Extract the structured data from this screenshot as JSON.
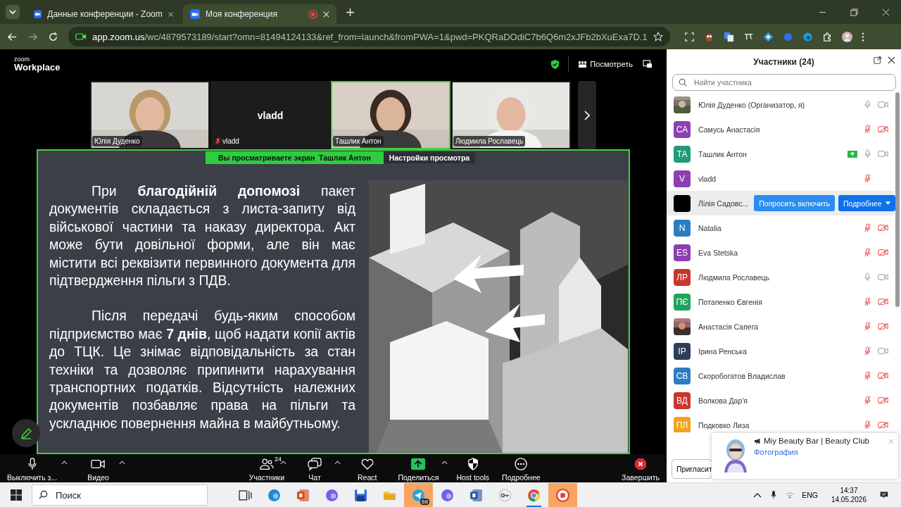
{
  "browser": {
    "tabs": [
      {
        "title": "Данные конференции - Zoom",
        "selected": false,
        "recording": false
      },
      {
        "title": "Моя конференция",
        "selected": true,
        "recording": true
      }
    ],
    "url": {
      "host": "app.zoom.us",
      "path": "/wc/4879573189/start?omn=81494124133&ref_from=launch&fromPWA=1&pwd=PKQRaDOdiC7b6Q6m2xJFb2bXuExa7D.1"
    }
  },
  "zoom": {
    "logo": {
      "top": "zoom",
      "bottom": "Workplace"
    },
    "view_button": "Посмотреть",
    "tiles": [
      {
        "kind": "video",
        "name": "Юлія Дуденко",
        "muted": false,
        "speaking": false
      },
      {
        "kind": "name",
        "display_name": "vladd",
        "name": "vladd",
        "muted": true,
        "speaking": false
      },
      {
        "kind": "video",
        "name": "Ташлик Антон",
        "muted": false,
        "speaking": true
      },
      {
        "kind": "video",
        "name": "Людмила Рославець",
        "muted": false,
        "speaking": false
      }
    ],
    "share_banner": {
      "text": "Вы просматриваете экран  Ташлик Антон",
      "settings": "Настройки просмотра"
    },
    "slide": {
      "paragraphs": [
        "При **благодійній допомозі** пакет документів складається з листа-запиту від військової частини та наказу директора. Акт може бути довільної форми, але він має містити всі реквізити первинного документа для підтвердження пільги з ПДВ.",
        "Після передачі будь-яким способом підприємство має **7 днів**, щоб надати копії актів до ТЦК. Це знімає відповідальність за стан техніки та дозволяє припинити нарахування транспортних податків. Відсутність належних документів позбавляє права на пільги та ускладнює повернення майна в майбутньому."
      ]
    },
    "toolbar": [
      {
        "kind": "mic",
        "label": "Выключить з...",
        "caret": true
      },
      {
        "kind": "video",
        "label": "Видео",
        "caret": true
      },
      {
        "kind": "participants",
        "label": "Участники",
        "badge": "24",
        "caret": true
      },
      {
        "kind": "chat",
        "label": "Чат",
        "caret": true
      },
      {
        "kind": "react",
        "label": "React",
        "caret": false
      },
      {
        "kind": "share",
        "label": "Поделиться",
        "caret": true
      },
      {
        "kind": "host",
        "label": "Host tools",
        "caret": false
      },
      {
        "kind": "more",
        "label": "Подробнее",
        "caret": false
      },
      {
        "kind": "end",
        "label": "Завершить",
        "caret": false
      }
    ]
  },
  "participants_panel": {
    "title": "Участники (24)",
    "search": {
      "placeholder": "Найти участника"
    },
    "participants": [
      {
        "name": "Юлія Дуденко (Организатор, я)",
        "mic_muted": false,
        "video_off": false,
        "sharing": false,
        "highlighted": false
      },
      {
        "name": "Самусь Анастасія",
        "avatar": {
          "kind": "initials",
          "initials": "СА",
          "color": "#8e3fb0"
        },
        "mic_muted": true,
        "video_off": true,
        "sharing": false,
        "highlighted": false
      },
      {
        "name": "Ташлик Антон",
        "avatar": {
          "kind": "initials",
          "initials": "ТА",
          "color": "#1f9a7a"
        },
        "mic_muted": false,
        "video_off": false,
        "sharing": true,
        "highlighted": false
      },
      {
        "name": "vladd",
        "avatar": {
          "kind": "initials",
          "initials": "V",
          "color": "#8e3fb0"
        },
        "mic_muted": true,
        "sharing": false,
        "highlighted": false
      },
      {
        "name": "Лілія Садовс...",
        "avatar": {
          "kind": "plain",
          "color": "#000000"
        },
        "sharing": false,
        "highlighted": true,
        "actions": [
          "Попросить включить",
          "Подробнее"
        ]
      },
      {
        "name": "Natalia",
        "avatar": {
          "kind": "initials",
          "initials": "N",
          "color": "#2e7cc0"
        },
        "mic_muted": true,
        "video_off": true,
        "sharing": false,
        "highlighted": false
      },
      {
        "name": "Eva Stetska",
        "avatar": {
          "kind": "initials",
          "initials": "ES",
          "color": "#8e3fb0"
        },
        "mic_muted": true,
        "video_off": true,
        "sharing": false,
        "highlighted": false
      },
      {
        "name": "Людмила Рославець",
        "avatar": {
          "kind": "initials",
          "initials": "ЛР",
          "color": "#c8362c"
        },
        "mic_muted": false,
        "video_off": false,
        "sharing": false,
        "highlighted": false
      },
      {
        "name": "Потапенко Євгенія",
        "avatar": {
          "kind": "initials",
          "initials": "ПЄ",
          "color": "#21a35b"
        },
        "mic_muted": true,
        "video_off": true,
        "sharing": false,
        "highlighted": false
      },
      {
        "name": "Анастасія Сапега",
        "mic_muted": true,
        "video_off": true,
        "sharing": false,
        "highlighted": false
      },
      {
        "name": "Ірина Ренська",
        "avatar": {
          "kind": "initials",
          "initials": "ІР",
          "color": "#2d3e58"
        },
        "mic_muted": true,
        "video_off": false,
        "sharing": false,
        "highlighted": false
      },
      {
        "name": "Скоробогатов Владислав",
        "avatar": {
          "kind": "initials",
          "initials": "СВ",
          "color": "#2e7cc0"
        },
        "mic_muted": true,
        "video_off": true,
        "sharing": false,
        "highlighted": false
      },
      {
        "name": "Волкова Дар'я",
        "avatar": {
          "kind": "initials",
          "initials": "ВД",
          "color": "#c8362c"
        },
        "mic_muted": true,
        "video_off": true,
        "sharing": false,
        "highlighted": false
      },
      {
        "name": "Подковко Лиза",
        "avatar": {
          "kind": "initials",
          "initials": "ПЛ",
          "color": "#f0a21e"
        },
        "mic_muted": true,
        "video_off": true,
        "sharing": false,
        "highlighted": false
      }
    ],
    "invite_button": "Пригласит"
  },
  "notification": {
    "title": "Miy Beauty Bar | Beauty Club",
    "subtitle": "Фотография"
  },
  "taskbar": {
    "search": {
      "placeholder": "Поиск"
    },
    "apps": [
      {
        "kind": "taskview",
        "flashing": false
      },
      {
        "kind": "edge",
        "flashing": false
      },
      {
        "kind": "powerpoint",
        "flashing": false
      },
      {
        "kind": "copilot",
        "flashing": false
      },
      {
        "kind": "floppy",
        "flashing": false
      },
      {
        "kind": "folder",
        "flashing": false
      },
      {
        "kind": "telegram",
        "flashing": true,
        "badge": "68"
      },
      {
        "kind": "viber",
        "flashing": false
      },
      {
        "kind": "word",
        "flashing": false
      },
      {
        "kind": "key",
        "flashing": false
      },
      {
        "kind": "chrome",
        "flashing": false,
        "open": true
      },
      {
        "kind": "redapp",
        "flashing": true
      }
    ],
    "language": "ENG",
    "time": "14:37",
    "date": "14.05.2026"
  }
}
